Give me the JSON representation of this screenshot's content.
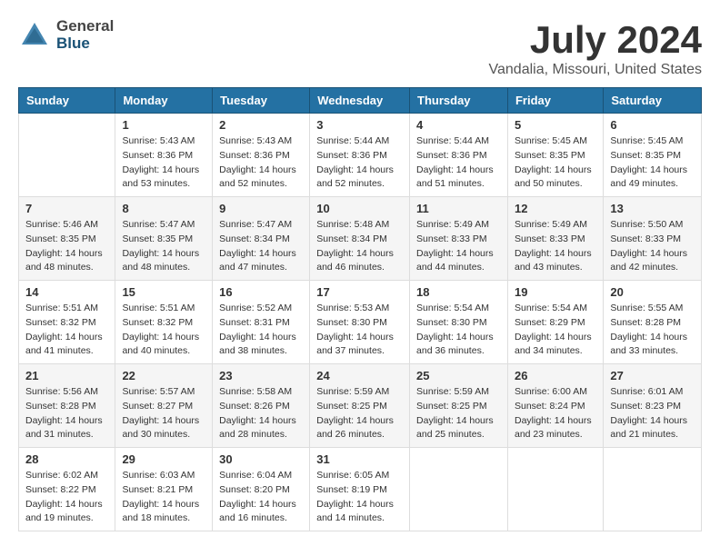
{
  "header": {
    "logo_general": "General",
    "logo_blue": "Blue",
    "title": "July 2024",
    "location": "Vandalia, Missouri, United States"
  },
  "columns": [
    "Sunday",
    "Monday",
    "Tuesday",
    "Wednesday",
    "Thursday",
    "Friday",
    "Saturday"
  ],
  "weeks": [
    [
      {
        "day": "",
        "info": ""
      },
      {
        "day": "1",
        "info": "Sunrise: 5:43 AM\nSunset: 8:36 PM\nDaylight: 14 hours\nand 53 minutes."
      },
      {
        "day": "2",
        "info": "Sunrise: 5:43 AM\nSunset: 8:36 PM\nDaylight: 14 hours\nand 52 minutes."
      },
      {
        "day": "3",
        "info": "Sunrise: 5:44 AM\nSunset: 8:36 PM\nDaylight: 14 hours\nand 52 minutes."
      },
      {
        "day": "4",
        "info": "Sunrise: 5:44 AM\nSunset: 8:36 PM\nDaylight: 14 hours\nand 51 minutes."
      },
      {
        "day": "5",
        "info": "Sunrise: 5:45 AM\nSunset: 8:35 PM\nDaylight: 14 hours\nand 50 minutes."
      },
      {
        "day": "6",
        "info": "Sunrise: 5:45 AM\nSunset: 8:35 PM\nDaylight: 14 hours\nand 49 minutes."
      }
    ],
    [
      {
        "day": "7",
        "info": "Sunrise: 5:46 AM\nSunset: 8:35 PM\nDaylight: 14 hours\nand 48 minutes."
      },
      {
        "day": "8",
        "info": "Sunrise: 5:47 AM\nSunset: 8:35 PM\nDaylight: 14 hours\nand 48 minutes."
      },
      {
        "day": "9",
        "info": "Sunrise: 5:47 AM\nSunset: 8:34 PM\nDaylight: 14 hours\nand 47 minutes."
      },
      {
        "day": "10",
        "info": "Sunrise: 5:48 AM\nSunset: 8:34 PM\nDaylight: 14 hours\nand 46 minutes."
      },
      {
        "day": "11",
        "info": "Sunrise: 5:49 AM\nSunset: 8:33 PM\nDaylight: 14 hours\nand 44 minutes."
      },
      {
        "day": "12",
        "info": "Sunrise: 5:49 AM\nSunset: 8:33 PM\nDaylight: 14 hours\nand 43 minutes."
      },
      {
        "day": "13",
        "info": "Sunrise: 5:50 AM\nSunset: 8:33 PM\nDaylight: 14 hours\nand 42 minutes."
      }
    ],
    [
      {
        "day": "14",
        "info": "Sunrise: 5:51 AM\nSunset: 8:32 PM\nDaylight: 14 hours\nand 41 minutes."
      },
      {
        "day": "15",
        "info": "Sunrise: 5:51 AM\nSunset: 8:32 PM\nDaylight: 14 hours\nand 40 minutes."
      },
      {
        "day": "16",
        "info": "Sunrise: 5:52 AM\nSunset: 8:31 PM\nDaylight: 14 hours\nand 38 minutes."
      },
      {
        "day": "17",
        "info": "Sunrise: 5:53 AM\nSunset: 8:30 PM\nDaylight: 14 hours\nand 37 minutes."
      },
      {
        "day": "18",
        "info": "Sunrise: 5:54 AM\nSunset: 8:30 PM\nDaylight: 14 hours\nand 36 minutes."
      },
      {
        "day": "19",
        "info": "Sunrise: 5:54 AM\nSunset: 8:29 PM\nDaylight: 14 hours\nand 34 minutes."
      },
      {
        "day": "20",
        "info": "Sunrise: 5:55 AM\nSunset: 8:28 PM\nDaylight: 14 hours\nand 33 minutes."
      }
    ],
    [
      {
        "day": "21",
        "info": "Sunrise: 5:56 AM\nSunset: 8:28 PM\nDaylight: 14 hours\nand 31 minutes."
      },
      {
        "day": "22",
        "info": "Sunrise: 5:57 AM\nSunset: 8:27 PM\nDaylight: 14 hours\nand 30 minutes."
      },
      {
        "day": "23",
        "info": "Sunrise: 5:58 AM\nSunset: 8:26 PM\nDaylight: 14 hours\nand 28 minutes."
      },
      {
        "day": "24",
        "info": "Sunrise: 5:59 AM\nSunset: 8:25 PM\nDaylight: 14 hours\nand 26 minutes."
      },
      {
        "day": "25",
        "info": "Sunrise: 5:59 AM\nSunset: 8:25 PM\nDaylight: 14 hours\nand 25 minutes."
      },
      {
        "day": "26",
        "info": "Sunrise: 6:00 AM\nSunset: 8:24 PM\nDaylight: 14 hours\nand 23 minutes."
      },
      {
        "day": "27",
        "info": "Sunrise: 6:01 AM\nSunset: 8:23 PM\nDaylight: 14 hours\nand 21 minutes."
      }
    ],
    [
      {
        "day": "28",
        "info": "Sunrise: 6:02 AM\nSunset: 8:22 PM\nDaylight: 14 hours\nand 19 minutes."
      },
      {
        "day": "29",
        "info": "Sunrise: 6:03 AM\nSunset: 8:21 PM\nDaylight: 14 hours\nand 18 minutes."
      },
      {
        "day": "30",
        "info": "Sunrise: 6:04 AM\nSunset: 8:20 PM\nDaylight: 14 hours\nand 16 minutes."
      },
      {
        "day": "31",
        "info": "Sunrise: 6:05 AM\nSunset: 8:19 PM\nDaylight: 14 hours\nand 14 minutes."
      },
      {
        "day": "",
        "info": ""
      },
      {
        "day": "",
        "info": ""
      },
      {
        "day": "",
        "info": ""
      }
    ]
  ]
}
